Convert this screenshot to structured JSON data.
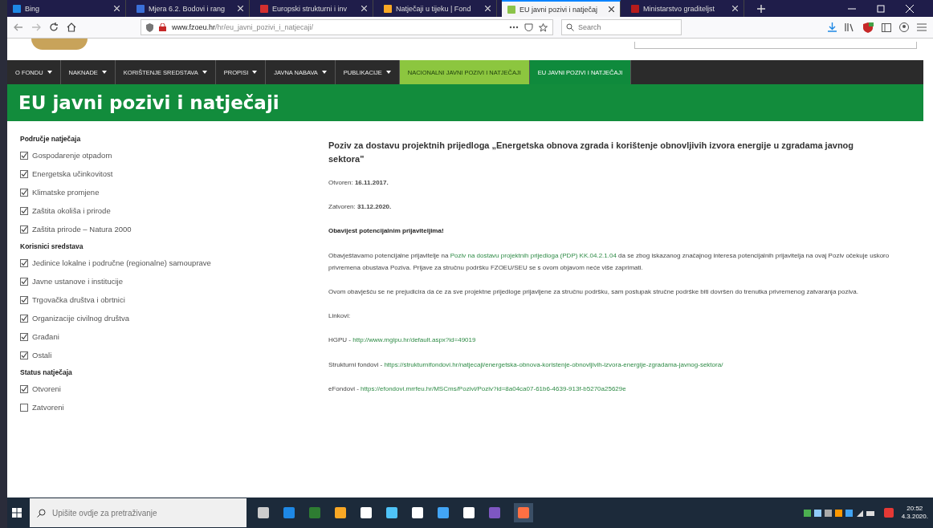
{
  "browser": {
    "tabs": [
      {
        "title": "Bing",
        "selected": false
      },
      {
        "title": "Mjera 6.2. Bodovi i rang",
        "selected": false
      },
      {
        "title": "Europski strukturni i inv",
        "selected": false
      },
      {
        "title": "Natječaji u tijeku | Fond",
        "selected": false
      },
      {
        "title": "EU javni pozivi i natječaj",
        "selected": true
      },
      {
        "title": "Ministarstvo graditeljst",
        "selected": false
      }
    ],
    "url_domain": "www.fzoeu.hr",
    "url_path": "/hr/eu_javni_pozivi_i_natjecaji/",
    "search": {
      "placeholder": "Search"
    }
  },
  "nav": [
    {
      "label": "O FONDU",
      "dropdown": true,
      "kind": "plain"
    },
    {
      "label": "NAKNADE",
      "dropdown": true,
      "kind": "plain"
    },
    {
      "label": "KORIŠTENJE SREDSTAVA",
      "dropdown": true,
      "kind": "plain"
    },
    {
      "label": "PROPISI",
      "dropdown": true,
      "kind": "plain"
    },
    {
      "label": "JAVNA NABAVA",
      "dropdown": true,
      "kind": "plain"
    },
    {
      "label": "PUBLIKACIJE",
      "dropdown": true,
      "kind": "plain"
    },
    {
      "label": "NACIONALNI JAVNI POZIVI I NATJEČAJI",
      "dropdown": false,
      "kind": "light"
    },
    {
      "label": "EU JAVNI POZIVI I NATJEČAJI",
      "dropdown": false,
      "kind": "active"
    }
  ],
  "page_title": "EU javni pozivi i natječaji",
  "filters": [
    {
      "title": "Područje natječaja",
      "items": [
        {
          "label": "Gospodarenje otpadom",
          "checked": true
        },
        {
          "label": "Energetska učinkovitost",
          "checked": true
        },
        {
          "label": "Klimatske promjene",
          "checked": true
        },
        {
          "label": "Zaštita okoliša i prirode",
          "checked": true
        },
        {
          "label": "Zaštita prirode – Natura 2000",
          "checked": true
        }
      ]
    },
    {
      "title": "Korisnici sredstava",
      "items": [
        {
          "label": "Jedinice lokalne i područne (regionalne) samouprave",
          "checked": true
        },
        {
          "label": "Javne ustanove i institucije",
          "checked": true
        },
        {
          "label": "Trgovačka društva i obrtnici",
          "checked": true
        },
        {
          "label": "Organizacije civilnog društva",
          "checked": true
        },
        {
          "label": "Građani",
          "checked": true
        },
        {
          "label": "Ostali",
          "checked": true
        }
      ]
    },
    {
      "title": "Status natječaja",
      "items": [
        {
          "label": "Otvoreni",
          "checked": true
        },
        {
          "label": "Zatvoreni",
          "checked": false
        }
      ]
    }
  ],
  "article": {
    "title": "Poziv za dostavu projektnih prijedloga „Energetska obnova zgrada i korištenje obnovljivih izvora energije u zgradama javnog sektora\"",
    "blocks": [
      {
        "kind": "text",
        "parts": [
          {
            "text": "Otvoren: **16.11.2017.**",
            "link": false
          }
        ]
      },
      {
        "kind": "text",
        "parts": [
          {
            "text": "Zatvoren: **31.12.2020.**",
            "link": false
          }
        ]
      },
      {
        "kind": "heading",
        "parts": [
          {
            "text": "Obavijest potencijalnim prijaviteljima!",
            "link": false
          }
        ]
      },
      {
        "kind": "text",
        "parts": [
          {
            "text": " Obavještavamo potencijalne prijavitelje na ",
            "link": false
          },
          {
            "text": "Poziv na dostavu projektnih prijedloga (PDP) KK.04.2.1.04",
            "link": true
          },
          {
            "text": " da se zbog iskazanog značajnog interesa potencijalnih prijavitelja na ovaj Poziv očekuje  uskoro privremena obustava Poziva. Prijave za stručnu podršku FZOEU/SEU se s ovom objavom neće više zaprimati.",
            "link": false
          }
        ]
      },
      {
        "kind": "text",
        "parts": [
          {
            "text": "Ovom obavješću se ne prejudicira da će za sve projektne prijedloge prijavljene za stručnu podršku, sam postupak stručne podrške biti dovršen do trenutka privremenog zatvaranja poziva.",
            "link": false
          }
        ]
      },
      {
        "kind": "text",
        "parts": [
          {
            "text": " Linkovi:",
            "link": false
          }
        ]
      },
      {
        "kind": "text",
        "parts": [
          {
            "text": " HGPU - ",
            "link": false
          },
          {
            "text": "http://www.mgipu.hr/default.aspx?id=49019",
            "link": true
          }
        ]
      },
      {
        "kind": "text",
        "parts": [
          {
            "text": " Strukturni fondovi - ",
            "link": false
          },
          {
            "text": "https://strukturnifondovi.hr/natjecaji/energetska-obnova-koristenje-obnovljivih-izvora-energije-zgradama-javnog-sektora/",
            "link": true
          }
        ]
      },
      {
        "kind": "text",
        "parts": [
          {
            "text": " eFondovi - ",
            "link": false
          },
          {
            "text": "https://efondovi.mrrfeu.hr/MSCms/Pozivi/Poziv?id=8a04ca07-61b6-4639-913f-b5270a25629e",
            "link": true
          }
        ]
      }
    ]
  },
  "taskbar": {
    "search_placeholder": "Upišite ovdje za pretraživanje",
    "time": "20:52",
    "date": "4.3.2020."
  }
}
